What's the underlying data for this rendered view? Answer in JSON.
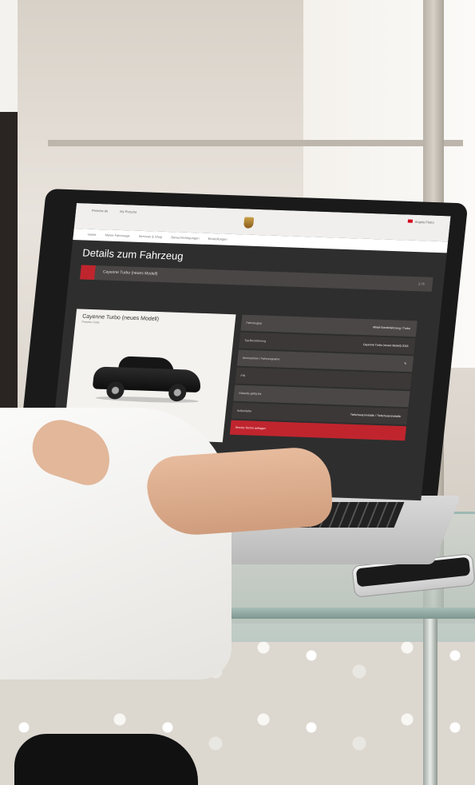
{
  "scene": {
    "description_free": true
  },
  "site": {
    "toplinks": [
      "Porsche.de",
      "My Porsche"
    ],
    "user_label": "Angela Pietro",
    "nav": [
      "Home",
      "Meine Fahrzeuge",
      "Services & Shop",
      "Benachrichtigungen",
      "Einstellungen"
    ],
    "page_title": "Details zum Fahrzeug",
    "model_bar_label": "Cayenne Turbo (neues Modell)",
    "model_bar_number": "1 / 6",
    "car_title": "Cayenne Turbo (neues Modell)",
    "car_subtitle": "Porsche Code",
    "spec_rows": [
      {
        "key": "Fahrzeugtyp",
        "value": "Allrad-Sonderfahrzeug / Turbo"
      },
      {
        "key": "Typ-Bezeichnung",
        "value": "Cayenne Turbo (neues Modell) 2018"
      },
      {
        "key": "Kennzeichen / Fahrzeugname",
        "value": ""
      },
      {
        "key": "FIN",
        "value": ""
      },
      {
        "key": "Garantie gültig bis",
        "value": ""
      },
      {
        "key": "Außenfarbe",
        "value": "Tiefschwarzmetallic / Tiefschwarzmetallic"
      }
    ],
    "cta_label": "Service-Termin anfragen"
  },
  "colors": {
    "accent": "#c0252e",
    "screen_bg": "#2e2e2e"
  }
}
